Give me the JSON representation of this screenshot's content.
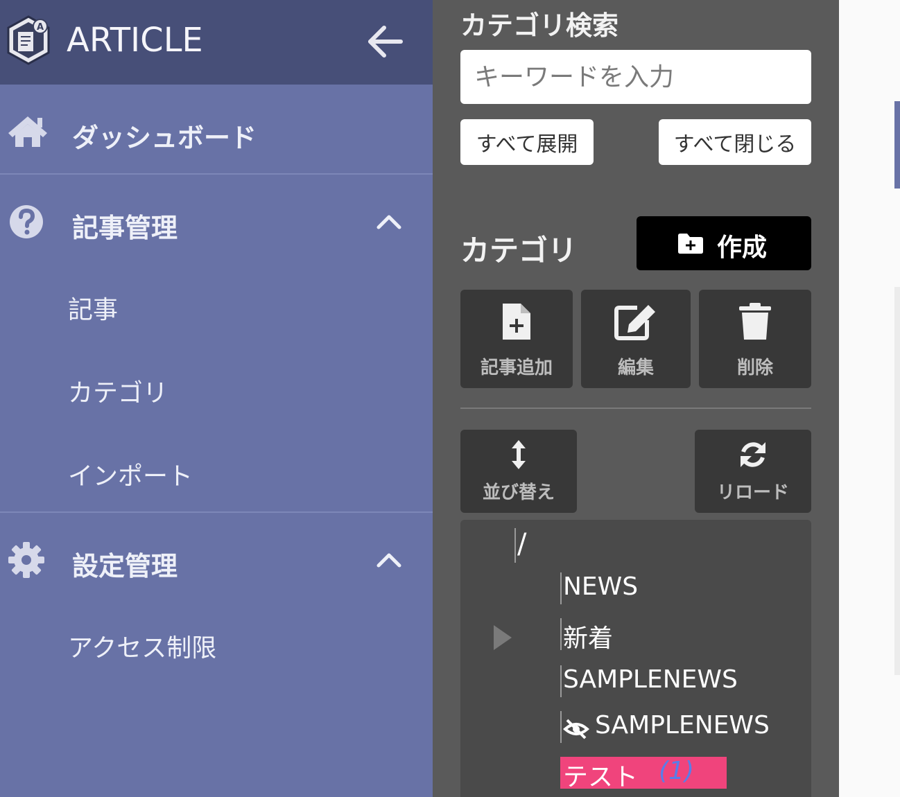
{
  "sidebar": {
    "title": "ARTICLE",
    "dashboard_label": "ダッシュボード",
    "groups": [
      {
        "label": "記事管理",
        "items": [
          "記事",
          "カテゴリ",
          "インポート"
        ]
      },
      {
        "label": "設定管理",
        "items": [
          "アクセス制限"
        ]
      }
    ],
    "colors": {
      "header": "#474f78",
      "body": "#6872a6"
    }
  },
  "panel": {
    "search_title": "カテゴリ検索",
    "search_placeholder": "キーワードを入力",
    "expand_all_label": "すべて展開",
    "collapse_all_label": "すべて閉じる",
    "category_title": "カテゴリ",
    "create_label": "作成",
    "tools": {
      "add_article": "記事追加",
      "edit": "編集",
      "delete": "削除",
      "sort": "並び替え",
      "reload": "リロード"
    },
    "tree": {
      "root": "/",
      "nodes": [
        "NEWS",
        "新着",
        "SAMPLENEWS",
        "SAMPLENEWS",
        "テスト"
      ],
      "selected_count": "(1)"
    },
    "colors": {
      "background": "#5a5a5a",
      "selected": "#f0447c"
    }
  }
}
